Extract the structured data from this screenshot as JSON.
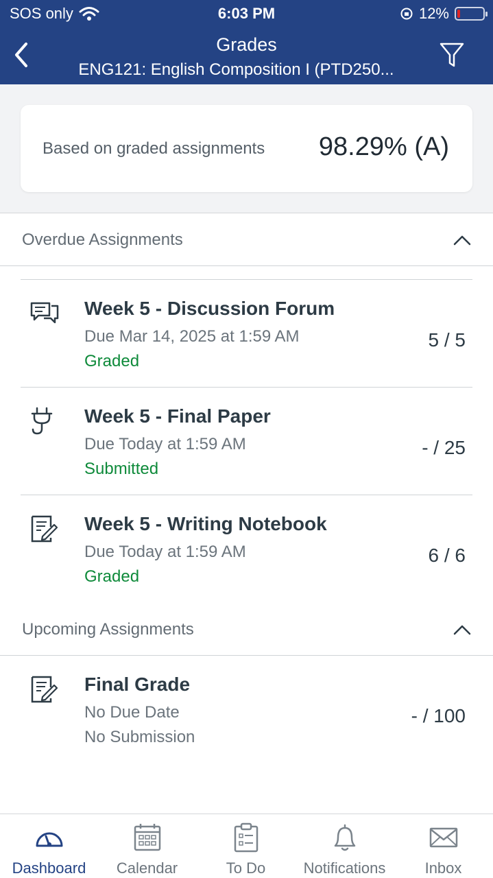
{
  "status_bar": {
    "carrier": "SOS only",
    "time": "6:03 PM",
    "battery_percent_label": "12%",
    "battery_level": 0.12
  },
  "nav": {
    "title": "Grades",
    "subtitle": "ENG121: English Composition I (PTD250..."
  },
  "summary": {
    "label": "Based on graded assignments",
    "value": "98.29% (A)"
  },
  "sections": {
    "overdue": {
      "title": "Overdue Assignments",
      "items": [
        {
          "icon": "discussion-icon",
          "name": "Week 5 - Discussion Forum",
          "due": "Due Mar 14, 2025 at 1:59 AM",
          "status": "Graded",
          "score": "5 / 5"
        },
        {
          "icon": "plug-icon",
          "name": "Week 5 - Final Paper",
          "due": "Due Today at 1:59 AM",
          "status": "Submitted",
          "score": "- / 25"
        },
        {
          "icon": "assignment-icon",
          "name": "Week 5 - Writing Notebook",
          "due": "Due Today at 1:59 AM",
          "status": "Graded",
          "score": "6 / 6"
        }
      ]
    },
    "upcoming": {
      "title": "Upcoming Assignments",
      "items": [
        {
          "icon": "assignment-icon",
          "name": "Final Grade",
          "due": "No Due Date",
          "status": "No Submission",
          "score": "- / 100"
        }
      ]
    }
  },
  "tabbar": {
    "items": [
      {
        "label": "Dashboard",
        "icon": "dashboard-icon",
        "active": true
      },
      {
        "label": "Calendar",
        "icon": "calendar-icon",
        "active": false
      },
      {
        "label": "To Do",
        "icon": "todo-icon",
        "active": false
      },
      {
        "label": "Notifications",
        "icon": "bell-icon",
        "active": false
      },
      {
        "label": "Inbox",
        "icon": "mail-icon",
        "active": false
      }
    ]
  },
  "colors": {
    "header_bg": "#244384",
    "status_green": "#0e8a3a",
    "battery_low": "#e02424"
  }
}
